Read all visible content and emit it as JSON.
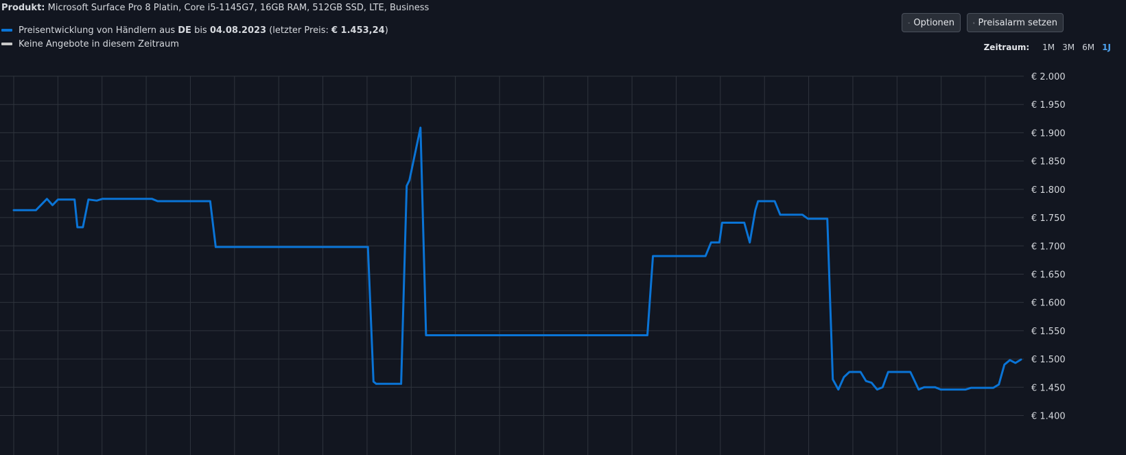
{
  "header": {
    "product_label": "Produkt:",
    "product_name": "Microsoft Surface Pro 8 Platin, Core i5-1145G7, 16GB RAM, 512GB SSD, LTE, Business"
  },
  "legend": {
    "series_prefix": "Preisentwicklung von Händlern aus",
    "country": "DE",
    "until_word": "bis",
    "date": "04.08.2023",
    "last_price_prefix": "(letzter Preis:",
    "last_price": "€ 1.453,24",
    "last_price_suffix": ")",
    "no_offers": "Keine Angebote in diesem Zeitraum",
    "series_color": "#0a74d6",
    "no_offers_color": "#c8c8c8"
  },
  "toolbar": {
    "options_label": "Optionen",
    "alarm_label": "Preisalarm setzen",
    "options_icon": "chevron-down-icon",
    "alarm_icon": "bell-icon"
  },
  "range": {
    "label": "Zeitraum:",
    "options": [
      "1M",
      "3M",
      "6M",
      "1J"
    ],
    "active": "1J"
  },
  "chart_data": {
    "type": "line",
    "currency": "€",
    "ylim": [
      1400,
      2000
    ],
    "yticks": [
      2000,
      1950,
      1900,
      1850,
      1800,
      1750,
      1700,
      1650,
      1600,
      1550,
      1500,
      1450,
      1400
    ],
    "ytick_labels": [
      "€ 2.000",
      "€ 1.950",
      "€ 1.900",
      "€ 1.850",
      "€ 1.800",
      "€ 1.750",
      "€ 1.700",
      "€ 1.650",
      "€ 1.600",
      "€ 1.550",
      "€ 1.500",
      "€ 1.450",
      "€ 1.400"
    ],
    "x_range": [
      0,
      365
    ],
    "grid": true,
    "line_color": "#0a74d6",
    "series": [
      {
        "points": [
          [
            0,
            1763
          ],
          [
            8,
            1763
          ],
          [
            12,
            1783
          ],
          [
            14,
            1772
          ],
          [
            16,
            1782
          ],
          [
            22,
            1782
          ],
          [
            23,
            1733
          ],
          [
            25,
            1733
          ],
          [
            27,
            1782
          ],
          [
            30,
            1780
          ],
          [
            32,
            1783
          ],
          [
            50,
            1783
          ],
          [
            52,
            1779
          ],
          [
            71,
            1779
          ],
          [
            73,
            1698
          ],
          [
            128,
            1698
          ],
          [
            130,
            1460
          ],
          [
            131,
            1456
          ],
          [
            140,
            1456
          ],
          [
            142,
            1806
          ],
          [
            143,
            1816
          ],
          [
            147,
            1909
          ],
          [
            149,
            1542
          ],
          [
            229,
            1542
          ],
          [
            231,
            1682
          ],
          [
            250,
            1682
          ],
          [
            252,
            1706
          ],
          [
            255,
            1706
          ],
          [
            256,
            1741
          ],
          [
            264,
            1741
          ],
          [
            266,
            1706
          ],
          [
            268,
            1763
          ],
          [
            269,
            1779
          ],
          [
            275,
            1779
          ],
          [
            277,
            1755
          ],
          [
            285,
            1755
          ],
          [
            287,
            1748
          ],
          [
            294,
            1748
          ],
          [
            296,
            1464
          ],
          [
            298,
            1446
          ],
          [
            300,
            1468
          ],
          [
            302,
            1477
          ],
          [
            306,
            1477
          ],
          [
            308,
            1461
          ],
          [
            310,
            1458
          ],
          [
            312,
            1446
          ],
          [
            314,
            1450
          ],
          [
            316,
            1477
          ],
          [
            324,
            1477
          ],
          [
            325,
            1467
          ],
          [
            327,
            1446
          ],
          [
            329,
            1450
          ],
          [
            333,
            1450
          ],
          [
            335,
            1446
          ],
          [
            344,
            1446
          ],
          [
            346,
            1449
          ],
          [
            354,
            1449
          ],
          [
            356,
            1455
          ],
          [
            358,
            1490
          ],
          [
            360,
            1498
          ],
          [
            362,
            1493
          ],
          [
            364,
            1499
          ]
        ]
      }
    ]
  }
}
